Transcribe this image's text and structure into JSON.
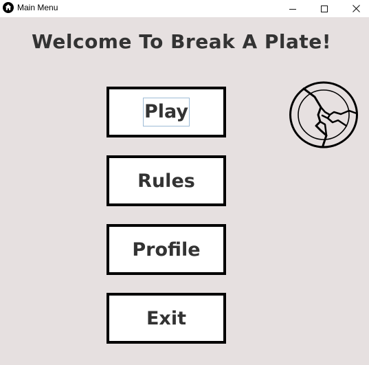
{
  "window": {
    "title": "Main Menu",
    "app_icon": "home-icon"
  },
  "controls": {
    "minimize_icon": "minimize-icon",
    "maximize_icon": "maximize-icon",
    "close_icon": "close-icon"
  },
  "heading": "Welcome To Break A Plate!",
  "menu": {
    "play": "Play",
    "rules": "Rules",
    "profile": "Profile",
    "exit": "Exit"
  },
  "logo_icon": "broken-plate-icon",
  "colors": {
    "background": "#e6e0e0",
    "button_bg": "#ffffff",
    "button_border": "#000000",
    "text": "#333333"
  }
}
